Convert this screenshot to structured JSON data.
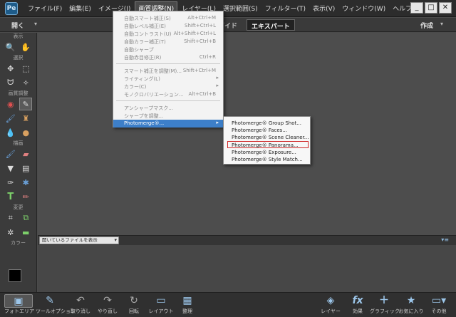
{
  "menubar": {
    "items": [
      "ファイル(F)",
      "編集(E)",
      "イメージ(I)",
      "画質調整(N)",
      "レイヤー(L)",
      "選択範囲(S)",
      "フィルター(T)",
      "表示(V)",
      "ウィンドウ(W)",
      "ヘルプ(H)"
    ],
    "active_index": 3,
    "app_icon": "Pe"
  },
  "window_controls": {
    "minimize": "_",
    "restore": "□",
    "close": "✕"
  },
  "modebar": {
    "open_label": "開く",
    "mode_guide": "ガイド",
    "mode_expert": "エキスパート",
    "create_label": "作成"
  },
  "toolbox": {
    "sections": [
      "表示",
      "選択",
      "画質調整",
      "描画",
      "変更",
      "カラー"
    ]
  },
  "menu": {
    "items": [
      {
        "label": "自動スマート補正(S)",
        "shortcut": "Alt+Ctrl+M"
      },
      {
        "label": "自動レベル補正(E)",
        "shortcut": "Shift+Ctrl+L"
      },
      {
        "label": "自動コントラスト(U)",
        "shortcut": "Alt+Shift+Ctrl+L"
      },
      {
        "label": "自動カラー補正(T)",
        "shortcut": "Shift+Ctrl+B"
      },
      {
        "label": "自動シャープ",
        "shortcut": ""
      },
      {
        "label": "自動赤目修正(R)",
        "shortcut": "Ctrl+R"
      },
      {
        "label": "スマート補正を調整(M)...",
        "shortcut": "Shift+Ctrl+M"
      },
      {
        "label": "ライティング(L)",
        "shortcut": ""
      },
      {
        "label": "カラー(C)",
        "shortcut": ""
      },
      {
        "label": "モノクロバリエーション...",
        "shortcut": "Alt+Ctrl+B"
      },
      {
        "label": "アンシャープマスク...",
        "shortcut": ""
      },
      {
        "label": "シャープを調整...",
        "shortcut": ""
      },
      {
        "label": "Photomerge®...",
        "shortcut": ""
      }
    ]
  },
  "submenu": {
    "items": [
      "Photomerge® Group Shot...",
      "Photomerge® Faces...",
      "Photomerge® Scene Cleaner...",
      "Photomerge® Panorama...",
      "Photomerge® Exposure...",
      "Photomerge® Style Match..."
    ],
    "highlighted_index": 3,
    "highlight_color": "#cf2727"
  },
  "photobin": {
    "select_value": "開いているファイルを表示",
    "options_icon": "▾≡"
  },
  "taskbar": {
    "left": [
      "フォトエリア",
      "ツールオプション",
      "取り消し",
      "やり直し",
      "回転",
      "レイアウト",
      "整理"
    ],
    "right": [
      "レイヤー",
      "効果",
      "グラフィック",
      "お気に入り",
      "その他"
    ]
  }
}
